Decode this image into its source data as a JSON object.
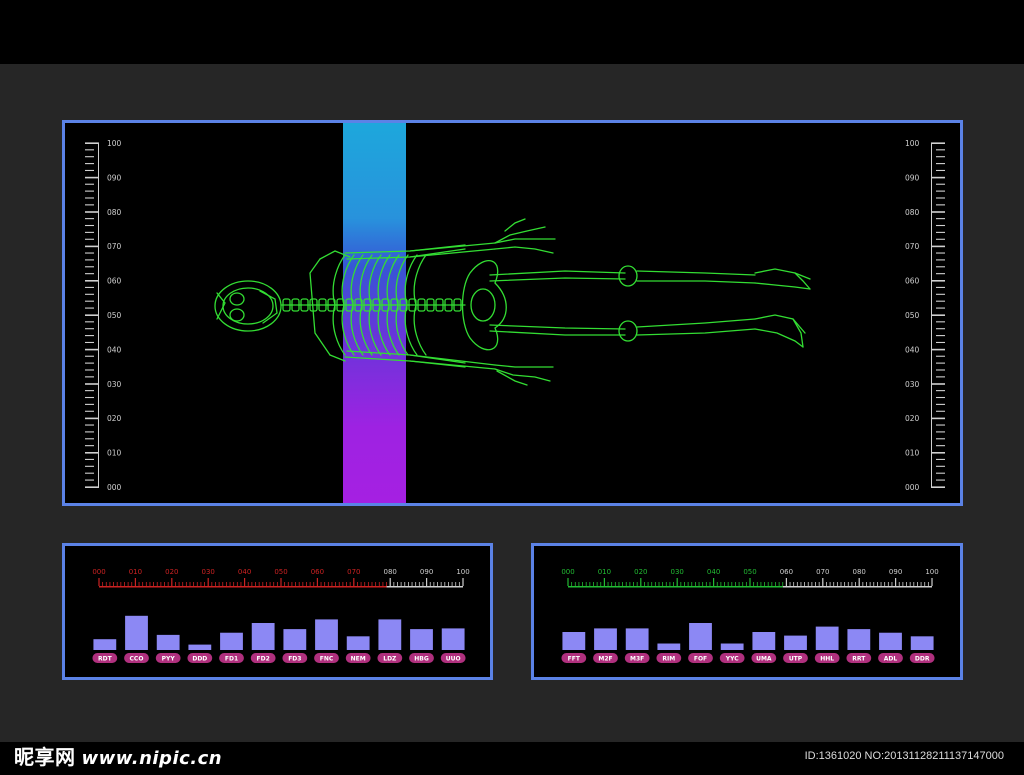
{
  "scale_left": {
    "labels": [
      "100",
      "090",
      "080",
      "070",
      "060",
      "050",
      "040",
      "030",
      "020",
      "010",
      "000"
    ]
  },
  "scale_right": {
    "labels": [
      "100",
      "090",
      "080",
      "070",
      "060",
      "050",
      "040",
      "030",
      "020",
      "010",
      "000"
    ]
  },
  "left_meter": {
    "accent": "#cc2222",
    "neutral": "#cfcfcf",
    "active_labels": [
      "000",
      "010",
      "020",
      "030",
      "040",
      "050",
      "060",
      "070"
    ],
    "inactive_labels": [
      "080",
      "090",
      "100"
    ],
    "bars": [
      {
        "label": "RDT",
        "level": 0.3
      },
      {
        "label": "CCO",
        "level": 0.95
      },
      {
        "label": "PYY",
        "level": 0.42
      },
      {
        "label": "DDD",
        "level": 0.15
      },
      {
        "label": "FD1",
        "level": 0.48
      },
      {
        "label": "FD2",
        "level": 0.75
      },
      {
        "label": "FD3",
        "level": 0.58
      },
      {
        "label": "FNC",
        "level": 0.85
      },
      {
        "label": "NEM",
        "level": 0.38
      },
      {
        "label": "LDZ",
        "level": 0.85
      },
      {
        "label": "HBG",
        "level": 0.58
      },
      {
        "label": "UUO",
        "level": 0.6
      }
    ]
  },
  "right_meter": {
    "accent": "#22bb33",
    "neutral": "#cfcfcf",
    "active_labels": [
      "000",
      "010",
      "020",
      "030",
      "040",
      "050"
    ],
    "inactive_labels": [
      "060",
      "070",
      "080",
      "090",
      "100"
    ],
    "bars": [
      {
        "label": "FFT",
        "level": 0.5
      },
      {
        "label": "M2F",
        "level": 0.6
      },
      {
        "label": "M3F",
        "level": 0.6
      },
      {
        "label": "RIM",
        "level": 0.18
      },
      {
        "label": "FOF",
        "level": 0.75
      },
      {
        "label": "YYC",
        "level": 0.18
      },
      {
        "label": "UMA",
        "level": 0.5
      },
      {
        "label": "UTP",
        "level": 0.4
      },
      {
        "label": "HHL",
        "level": 0.65
      },
      {
        "label": "RRT",
        "level": 0.58
      },
      {
        "label": "ADL",
        "level": 0.48
      },
      {
        "label": "DDR",
        "level": 0.38
      }
    ]
  },
  "colors": {
    "panel_border": "#5b82e6",
    "bar_fill": "#8c88f4",
    "bar_label_bg": "#b0307e",
    "skeleton": "#33dd33"
  },
  "icons": {
    "skeleton": "skeleton-xray-icon"
  },
  "watermark": {
    "site_name": "昵享网",
    "site_url": "www.nipic.cn",
    "id_text": "ID:1361020 NO:20131128211137147000"
  }
}
